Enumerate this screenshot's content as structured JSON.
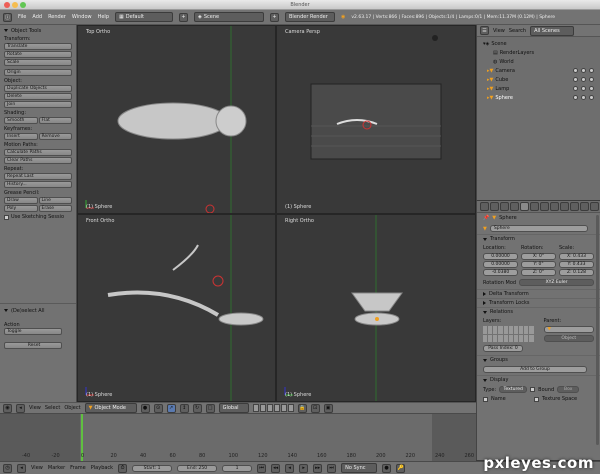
{
  "window": {
    "title": "Blender"
  },
  "menubar": {
    "items": [
      "File",
      "Add",
      "Render",
      "Window",
      "Help"
    ],
    "layout": "Default",
    "scene": "Scene",
    "engine": "Blender Render",
    "stats": "v2.63.17 | Verts:866 | Faces:896 | Objects:1/4 | Lamps:0/1 | Mem:11.37M (0.12M) | Sphere"
  },
  "toolshelf": {
    "title": "Object Tools",
    "transform_label": "Transform:",
    "translate": "Translate",
    "rotate": "Rotate",
    "scale": "Scale",
    "origin": "Origin",
    "object_label": "Object:",
    "duplicate": "Duplicate Objects",
    "delete": "Delete",
    "join": "Join",
    "shading_label": "Shading:",
    "smooth": "Smooth",
    "flat": "Flat",
    "keyframes_label": "Keyframes:",
    "insert": "Insert",
    "remove": "Remove",
    "motion_label": "Motion Paths:",
    "calc_paths": "Calculate Paths",
    "clear_paths": "Clear Paths",
    "repeat_label": "Repeat:",
    "repeat_last": "Repeat Last",
    "history": "History...",
    "grease_label": "Grease Pencil:",
    "draw": "Draw",
    "line": "Line",
    "poly": "Poly",
    "erase": "Erase",
    "use_sketching": "Use Sketching Sessio",
    "deselect": "(De)select All",
    "action_label": "Action",
    "action_value": "Toggle",
    "reset": "Reset"
  },
  "viewports": {
    "top": {
      "label": "Top Ortho",
      "object": "(1) Sphere"
    },
    "camera": {
      "label": "Camera Persp",
      "object": "(1) Sphere"
    },
    "front": {
      "label": "Front Ortho",
      "object": "(1) Sphere"
    },
    "right": {
      "label": "Right Ortho",
      "object": "(1) Sphere"
    }
  },
  "outliner": {
    "view": "View",
    "search": "Search",
    "filter": "All Scenes",
    "items": [
      "Scene",
      "RenderLayers",
      "World",
      "Camera",
      "Cube",
      "Lamp",
      "Sphere"
    ]
  },
  "properties": {
    "object_name": "Sphere",
    "breadcrumb": "Sphere",
    "transform": "Transform",
    "location": "Location:",
    "rotation": "Rotation:",
    "scale": "Scale:",
    "loc": [
      "0.00000",
      "0.00000",
      "-0.0380"
    ],
    "rot": [
      "X: 0°",
      "Y: 0°",
      "Z: 0°"
    ],
    "scl": [
      "X: 0.433",
      "Y: 0.433",
      "Z: 0.128"
    ],
    "rotation_mode_label": "Rotation Mod",
    "rotation_mode": "XYZ Euler",
    "delta": "Delta Transform",
    "locks": "Transform Locks",
    "relations": "Relations",
    "layers": "Layers:",
    "parent": "Parent:",
    "parent_type": "Object",
    "pass_index": "Pass Index: 0",
    "groups": "Groups",
    "add_group": "Add to Group",
    "display": "Display",
    "type_label": "Type:",
    "type_value": "Textured",
    "bound": "Bound",
    "bound_value": "Box",
    "name": "Name",
    "texture_space": "Texture Space"
  },
  "view3d_header": {
    "view": "View",
    "select": "Select",
    "object": "Object",
    "mode": "Object Mode",
    "orientation": "Global"
  },
  "timeline": {
    "ticks": [
      "-40",
      "-20",
      "0",
      "20",
      "40",
      "60",
      "80",
      "100",
      "120",
      "140",
      "160",
      "180",
      "200",
      "220",
      "240",
      "260"
    ],
    "view": "View",
    "marker": "Marker",
    "frame": "Frame",
    "playback": "Playback",
    "start": "Start: 1",
    "end": "End: 250",
    "current": "1",
    "sync": "No Sync"
  },
  "watermark": "pxleyes.com",
  "colors": {
    "accent": "#f0a020",
    "selected": "#ff8c00",
    "viewport": "#393939",
    "panel": "#727272"
  }
}
